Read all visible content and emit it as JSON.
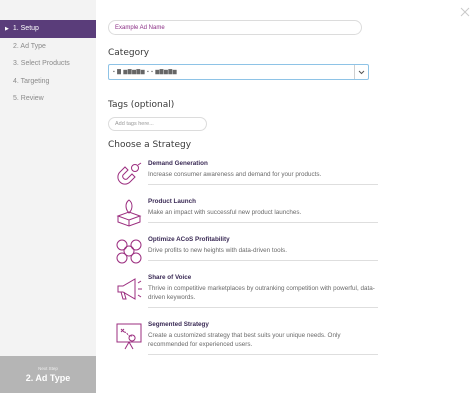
{
  "sidebar": {
    "steps": [
      {
        "label": "1. Setup"
      },
      {
        "label": "2. Ad Type"
      },
      {
        "label": "3. Select Products"
      },
      {
        "label": "4. Targeting"
      },
      {
        "label": "5. Review"
      }
    ],
    "next": {
      "small": "Next Step",
      "big": "2. Ad Type"
    }
  },
  "ad_name": {
    "value": "Example Ad Name"
  },
  "category": {
    "title": "Category",
    "value": "▪ ▇ ▆▇▆▇▆  ▪ ▪ ▆▇▆▇▆"
  },
  "tags": {
    "title": "Tags (optional)",
    "placeholder": "Add tags here..."
  },
  "strategy": {
    "title": "Choose a Strategy",
    "items": [
      {
        "title": "Demand Generation",
        "desc": "Increase consumer awareness and demand for your products.",
        "icon": "magnet-icon"
      },
      {
        "title": "Product Launch",
        "desc": "Make an impact with successful new product launches.",
        "icon": "rocket-box-icon"
      },
      {
        "title": "Optimize ACoS Profitability",
        "desc": "Drive profits to new heights with data-driven tools.",
        "icon": "coins-icon"
      },
      {
        "title": "Share of Voice",
        "desc": "Thrive in competitive marketplaces by outranking competition with powerful, data-driven keywords.",
        "icon": "megaphone-icon"
      },
      {
        "title": "Segmented Strategy",
        "desc": "Create a customized strategy that best suits your unique needs. Only recommended for experienced users.",
        "icon": "strategy-board-icon"
      }
    ]
  },
  "colors": {
    "accent": "#5a3d7a",
    "icon": "#9b2d7f",
    "select_border": "#8ec3e6"
  }
}
